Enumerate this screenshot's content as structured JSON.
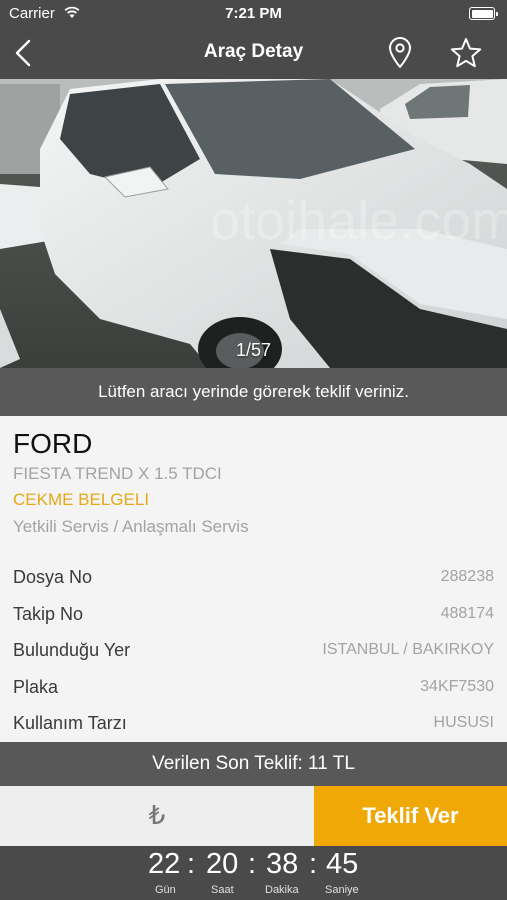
{
  "status_bar": {
    "carrier": "Carrier",
    "time": "7:21 PM"
  },
  "nav": {
    "title": "Araç Detay",
    "icons": [
      "back-chevron-icon",
      "location-pin-icon",
      "star-icon"
    ]
  },
  "gallery": {
    "counter": "1/57",
    "watermark": "otoihale.com"
  },
  "notice": "Lütfen aracı yerinde görerek teklif veriniz.",
  "vehicle": {
    "make": "FORD",
    "model": "FIESTA TREND X 1.5 TDCI",
    "status": "CEKME BELGELI",
    "service": "Yetkili Servis / Anlaşmalı Servis",
    "details": [
      {
        "label": "Dosya No",
        "value": "288238"
      },
      {
        "label": "Takip No",
        "value": "488174"
      },
      {
        "label": "Bulunduğu Yer",
        "value": "ISTANBUL / BAKIRKOY"
      },
      {
        "label": "Plaka",
        "value": "34KF7530"
      },
      {
        "label": "Kullanım Tarzı",
        "value": "HUSUSI"
      }
    ]
  },
  "bid": {
    "last_bid": "Verilen Son Teklif: 11 TL",
    "placeholder": "₺",
    "button": "Teklif Ver"
  },
  "countdown": {
    "days": "22",
    "hours": "20",
    "minutes": "38",
    "seconds": "45",
    "separator": ":",
    "days_label": "Gün",
    "hours_label": "Saat",
    "minutes_label": "Dakika",
    "seconds_label": "Saniye"
  },
  "colors": {
    "bar": "#4a4a4a",
    "accent": "#efa806",
    "status": "#e6a817"
  }
}
